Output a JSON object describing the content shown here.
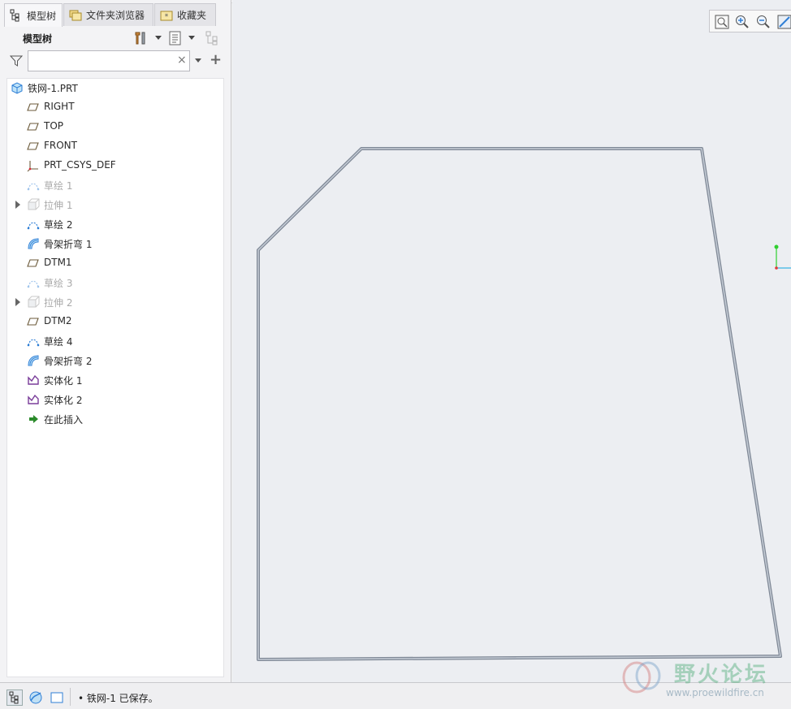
{
  "tabs": [
    {
      "label": "模型树",
      "icon": "model-tree-icon",
      "active": true
    },
    {
      "label": "文件夹浏览器",
      "icon": "folder-browser-icon",
      "active": false
    },
    {
      "label": "收藏夹",
      "icon": "favorites-icon",
      "active": false
    }
  ],
  "tree_header": {
    "title": "模型树"
  },
  "search": {
    "value": "",
    "placeholder": "",
    "clear_glyph": "×",
    "add_glyph": "+"
  },
  "tree": {
    "root": {
      "label": "铁网-1.PRT",
      "icon": "part-icon"
    },
    "items": [
      {
        "label": "RIGHT",
        "icon": "datum-plane-icon",
        "disabled": false,
        "expandable": false
      },
      {
        "label": "TOP",
        "icon": "datum-plane-icon",
        "disabled": false,
        "expandable": false
      },
      {
        "label": "FRONT",
        "icon": "datum-plane-icon",
        "disabled": false,
        "expandable": false
      },
      {
        "label": "PRT_CSYS_DEF",
        "icon": "coordinate-system-icon",
        "disabled": false,
        "expandable": false
      },
      {
        "label": "草绘 1",
        "icon": "sketch-icon",
        "disabled": true,
        "expandable": false
      },
      {
        "label": "拉伸 1",
        "icon": "extrude-icon",
        "disabled": true,
        "expandable": true
      },
      {
        "label": "草绘 2",
        "icon": "sketch-icon",
        "disabled": false,
        "expandable": false
      },
      {
        "label": "骨架折弯 1",
        "icon": "spinal-bend-icon",
        "disabled": false,
        "expandable": false
      },
      {
        "label": "DTM1",
        "icon": "datum-plane-icon",
        "disabled": false,
        "expandable": false
      },
      {
        "label": "草绘 3",
        "icon": "sketch-icon",
        "disabled": true,
        "expandable": false
      },
      {
        "label": "拉伸 2",
        "icon": "extrude-icon",
        "disabled": true,
        "expandable": true
      },
      {
        "label": "DTM2",
        "icon": "datum-plane-icon",
        "disabled": false,
        "expandable": false
      },
      {
        "label": "草绘 4",
        "icon": "sketch-icon",
        "disabled": false,
        "expandable": false
      },
      {
        "label": "骨架折弯 2",
        "icon": "spinal-bend-icon",
        "disabled": false,
        "expandable": false
      },
      {
        "label": "实体化 1",
        "icon": "solidify-icon",
        "disabled": false,
        "expandable": false
      },
      {
        "label": "实体化 2",
        "icon": "solidify-icon",
        "disabled": false,
        "expandable": false
      },
      {
        "label": "在此插入",
        "icon": "insert-here-arrow-icon",
        "disabled": false,
        "expandable": false
      }
    ]
  },
  "status": {
    "message": "铁网-1 已保存。"
  },
  "watermark": {
    "title": "野火论坛",
    "url": "www.proewildfire.cn"
  },
  "colors": {
    "accent": "#2f7fd6",
    "insert_arrow": "#2a8a2a",
    "solidify": "#7a3d9a",
    "part_edge": "#8f98a6"
  }
}
